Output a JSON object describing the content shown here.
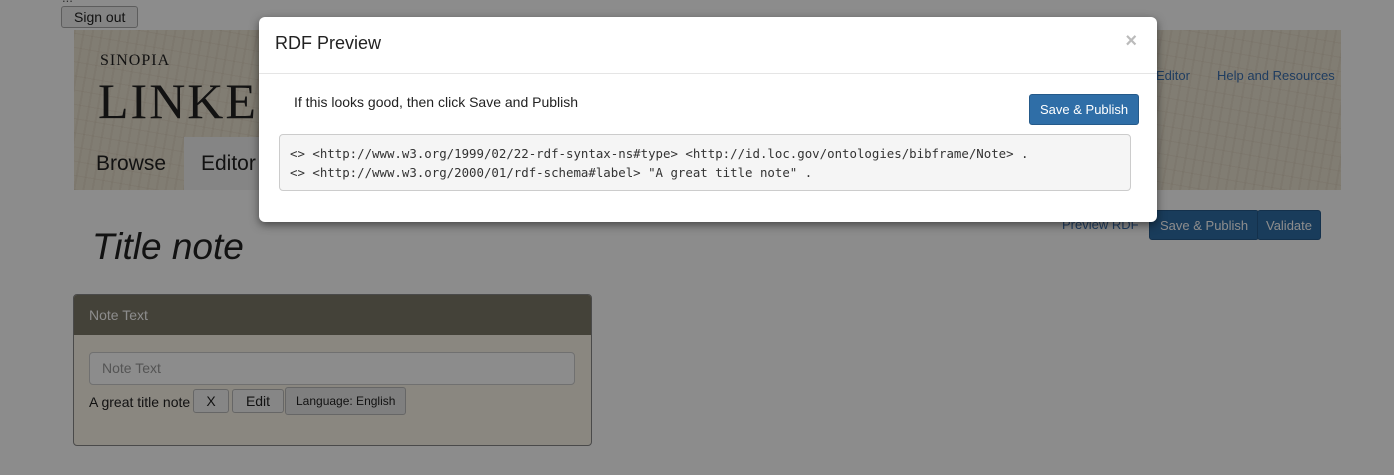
{
  "topbar": {
    "clipped_text": "...",
    "signout_label": "Sign out"
  },
  "banner": {
    "sinopia": "SINOPIA",
    "title": "LINKE",
    "nav_editor": "Editor",
    "nav_help": "Help and Resources"
  },
  "tabs": [
    {
      "label": "Browse"
    },
    {
      "label": "Editor"
    }
  ],
  "resource": {
    "title": "Title note"
  },
  "actions": {
    "preview_label": "Preview RDF",
    "save_publish_label": "Save & Publish",
    "validate_label": "Validate"
  },
  "panel": {
    "header": "Note Text",
    "input_placeholder": "Note Text",
    "literal_value": "A great title note",
    "remove_label": "X",
    "edit_label": "Edit",
    "language_label": "Language: English"
  },
  "modal": {
    "title": "RDF Preview",
    "close_symbol": "×",
    "message": "If this looks good, then click Save and Publish",
    "save_label": "Save & Publish",
    "rdf_lines": [
      "<> <http://www.w3.org/1999/02/22-rdf-syntax-ns#type> <http://id.loc.gov/ontologies/bibframe/Note> .",
      "<> <http://www.w3.org/2000/01/rdf-schema#label> \"A great title note\" ."
    ]
  },
  "colors": {
    "primary": "#2f6ea7",
    "panel_header": "#7d7869",
    "link": "#3a6fb0"
  }
}
